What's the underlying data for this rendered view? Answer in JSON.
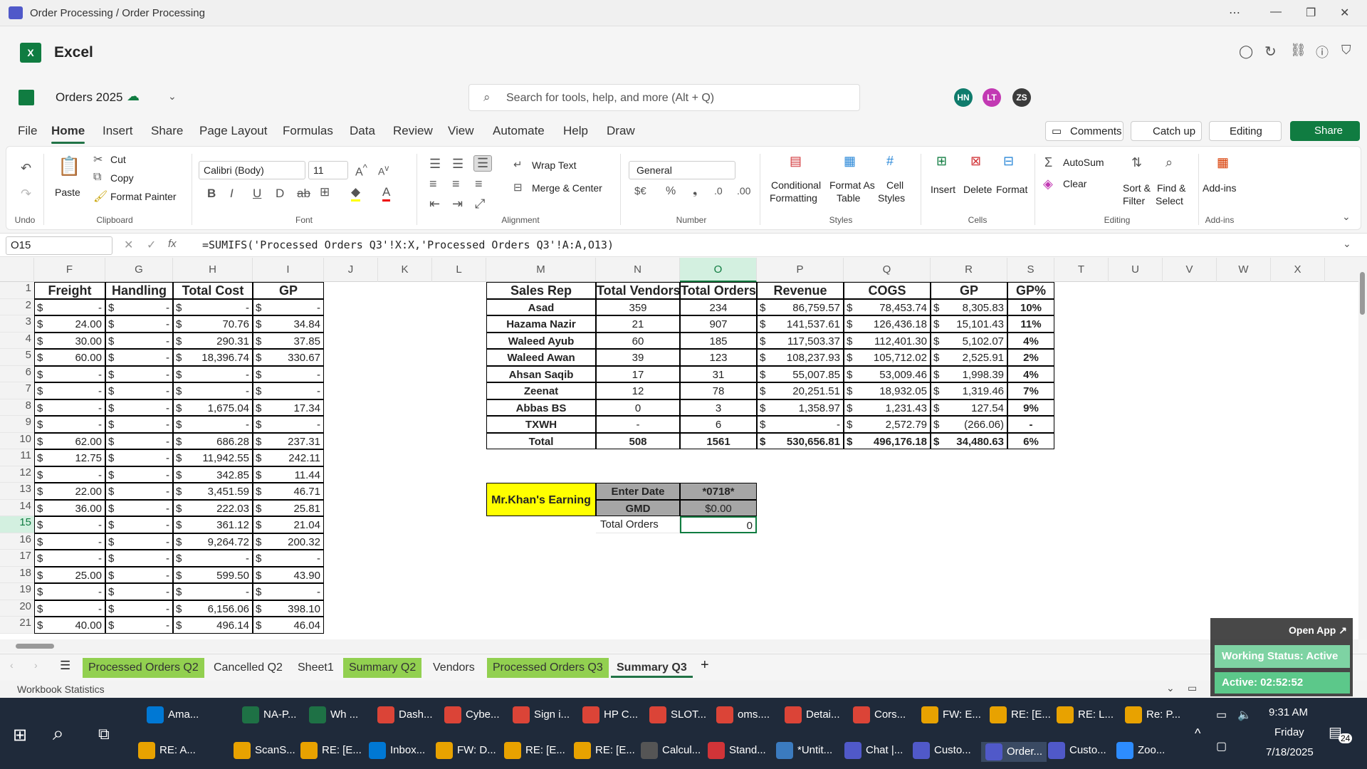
{
  "window": {
    "title": "Order Processing / Order Processing"
  },
  "app": {
    "name": "Excel"
  },
  "doc": {
    "name": "Orders 2025",
    "search_placeholder": "Search for tools, help, and more (Alt + Q)",
    "avatars": [
      "HN",
      "LT",
      "ZS"
    ],
    "comments": "Comments",
    "catchup": "Catch up",
    "editing": "Editing",
    "share": "Share"
  },
  "tabs": [
    "File",
    "Home",
    "Insert",
    "Share",
    "Page Layout",
    "Formulas",
    "Data",
    "Review",
    "View",
    "Automate",
    "Help",
    "Draw"
  ],
  "ribbon": {
    "undo": "Undo",
    "paste": "Paste",
    "cut": "Cut",
    "copy": "Copy",
    "format_painter": "Format Painter",
    "clipboard": "Clipboard",
    "font_name": "Calibri (Body)",
    "font_size": "11",
    "font": "Font",
    "wrap": "Wrap Text",
    "merge": "Merge & Center",
    "alignment": "Alignment",
    "number_format": "General",
    "number": "Number",
    "cond1": "Conditional",
    "cond2": "Formatting",
    "fmt1": "Format As",
    "fmt2": "Table",
    "cs1": "Cell",
    "cs2": "Styles",
    "styles": "Styles",
    "insert": "Insert",
    "delete": "Delete",
    "format": "Format",
    "cells": "Cells",
    "autosum": "AutoSum",
    "clear": "Clear",
    "sort1": "Sort &",
    "sort2": "Filter",
    "find1": "Find &",
    "find2": "Select",
    "editing": "Editing",
    "addins": "Add-ins",
    "addins_grp": "Add-ins"
  },
  "formula_bar": {
    "name_box": "O15",
    "formula": "=SUMIFS('Processed Orders Q3'!X:X,'Processed Orders Q3'!A:A,O13)"
  },
  "columns": [
    "F",
    "G",
    "H",
    "I",
    "J",
    "K",
    "L",
    "M",
    "N",
    "O",
    "P",
    "Q",
    "R",
    "S",
    "T",
    "U",
    "V",
    "W",
    "X"
  ],
  "rows": [
    "1",
    "2",
    "3",
    "4",
    "5",
    "6",
    "7",
    "8",
    "9",
    "10",
    "11",
    "12",
    "13",
    "14",
    "15",
    "16",
    "17",
    "18",
    "19",
    "20",
    "21"
  ],
  "left_table": {
    "headers": [
      "Freight",
      "Handling",
      "Total Cost",
      "GP"
    ],
    "rows": [
      [
        "-",
        "-",
        "-",
        "-"
      ],
      [
        "24.00",
        "-",
        "70.76",
        "34.84"
      ],
      [
        "30.00",
        "-",
        "290.31",
        "37.85"
      ],
      [
        "60.00",
        "-",
        "18,396.74",
        "330.67"
      ],
      [
        "-",
        "-",
        "-",
        "-"
      ],
      [
        "-",
        "-",
        "-",
        "-"
      ],
      [
        "-",
        "-",
        "1,675.04",
        "17.34"
      ],
      [
        "-",
        "-",
        "-",
        "-"
      ],
      [
        "62.00",
        "-",
        "686.28",
        "237.31"
      ],
      [
        "12.75",
        "-",
        "11,942.55",
        "242.11"
      ],
      [
        "-",
        "-",
        "342.85",
        "11.44"
      ],
      [
        "22.00",
        "-",
        "3,451.59",
        "46.71"
      ],
      [
        "36.00",
        "-",
        "222.03",
        "25.81"
      ],
      [
        "-",
        "-",
        "361.12",
        "21.04"
      ],
      [
        "-",
        "-",
        "9,264.72",
        "200.32"
      ],
      [
        "-",
        "-",
        "-",
        "-"
      ],
      [
        "25.00",
        "-",
        "599.50",
        "43.90"
      ],
      [
        "-",
        "-",
        "-",
        "-"
      ],
      [
        "-",
        "-",
        "6,156.06",
        "398.10"
      ],
      [
        "40.00",
        "-",
        "496.14",
        "46.04"
      ]
    ]
  },
  "summary_table": {
    "headers": [
      "Sales Rep",
      "Total Vendors",
      "Total Orders",
      "Revenue",
      "COGS",
      "GP",
      "GP%"
    ],
    "rows": [
      [
        "Asad",
        "359",
        "234",
        "86,759.57",
        "78,453.74",
        "8,305.83",
        "10%"
      ],
      [
        "Hazama Nazir",
        "21",
        "907",
        "141,537.61",
        "126,436.18",
        "15,101.43",
        "11%"
      ],
      [
        "Waleed Ayub",
        "60",
        "185",
        "117,503.37",
        "112,401.30",
        "5,102.07",
        "4%"
      ],
      [
        "Waleed Awan",
        "39",
        "123",
        "108,237.93",
        "105,712.02",
        "2,525.91",
        "2%"
      ],
      [
        "Ahsan Saqib",
        "17",
        "31",
        "55,007.85",
        "53,009.46",
        "1,998.39",
        "4%"
      ],
      [
        "Zeenat",
        "12",
        "78",
        "20,251.51",
        "18,932.05",
        "1,319.46",
        "7%"
      ],
      [
        "Abbas BS",
        "0",
        "3",
        "1,358.97",
        "1,231.43",
        "127.54",
        "9%"
      ],
      [
        "TXWH",
        "-",
        "6",
        "-",
        "2,572.79",
        "(266.06)",
        "-"
      ],
      [
        "Total",
        "508",
        "1561",
        "530,656.81",
        "496,176.18",
        "34,480.63",
        "6%"
      ]
    ]
  },
  "earning": {
    "title": "Mr.Khan's Earning",
    "enter_date_label": "Enter Date",
    "enter_date_value": "*0718*",
    "gmd_label": "GMD",
    "gmd_value": "$0.00",
    "total_orders_label": "Total Orders",
    "total_orders_value": "0"
  },
  "currency": "$",
  "sheets": [
    {
      "name": "Processed Orders Q2",
      "green": true
    },
    {
      "name": "Cancelled Q2",
      "green": false
    },
    {
      "name": "Sheet1",
      "green": false
    },
    {
      "name": "Summary Q2",
      "green": true
    },
    {
      "name": "Vendors",
      "green": false
    },
    {
      "name": "Processed Orders Q3",
      "green": true
    },
    {
      "name": "Summary Q3",
      "green": false
    }
  ],
  "status": {
    "left": "Workbook Statistics"
  },
  "overlay": {
    "open_app": "Open App ↗",
    "working": "Working Status: Active",
    "active": "Active: 02:52:52"
  },
  "taskbar": {
    "row1": [
      "Ama...",
      "NA-P...",
      "Wh ...",
      "Dash...",
      "Cybe...",
      "Sign i...",
      "HP C...",
      "SLOT...",
      "oms....",
      "Detai...",
      "Cors...",
      "FW: E...",
      "RE: [E...",
      "RE: L...",
      "Re: P..."
    ],
    "row2": [
      "RE: A...",
      "ScanS...",
      "RE: [E...",
      "Inbox...",
      "FW: D...",
      "RE: [E...",
      "RE: [E...",
      "Calcul...",
      "Stand...",
      "*Untit...",
      "Chat |...",
      "Custo...",
      "Order...",
      "Custo...",
      "Zoo..."
    ],
    "time": "9:31 AM",
    "day": "Friday",
    "date": "7/18/2025",
    "badge": "24"
  }
}
